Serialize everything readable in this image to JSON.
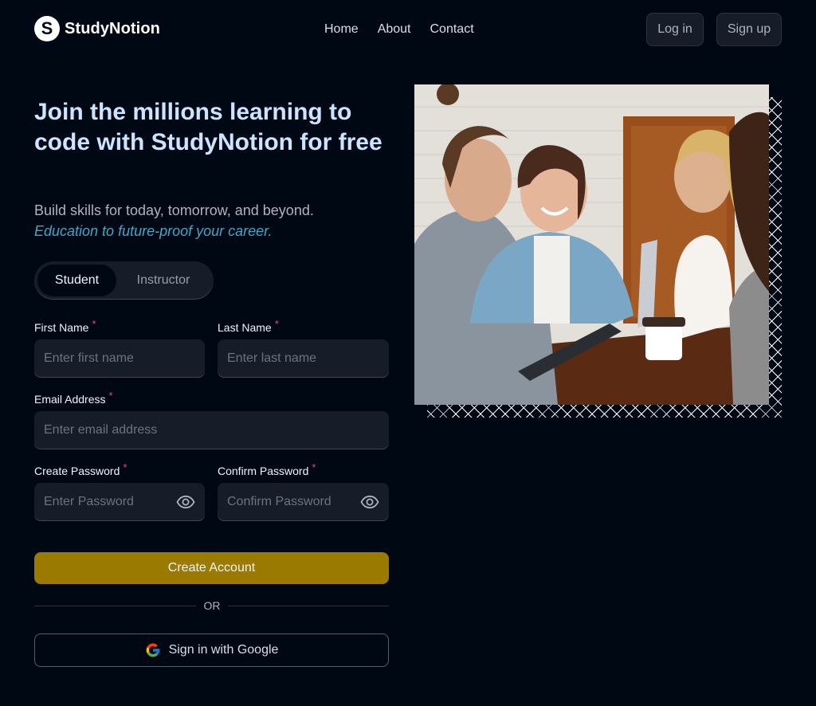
{
  "brand": {
    "name": "StudyNotion",
    "mark": "S"
  },
  "nav": {
    "links": [
      "Home",
      "About",
      "Contact"
    ],
    "login": "Log in",
    "signup": "Sign up"
  },
  "hero": {
    "heading": "Join the millions learning to code with StudyNotion for free",
    "sub1": "Build skills for today, tomorrow, and beyond.",
    "sub2": "Education to future-proof your career."
  },
  "account_type": {
    "options": [
      "Student",
      "Instructor"
    ],
    "selected": "Student"
  },
  "form": {
    "first_name": {
      "label": "First Name",
      "placeholder": "Enter first name"
    },
    "last_name": {
      "label": "Last Name",
      "placeholder": "Enter last name"
    },
    "email": {
      "label": "Email Address",
      "placeholder": "Enter email address"
    },
    "password": {
      "label": "Create Password",
      "placeholder": "Enter Password"
    },
    "confirm_password": {
      "label": "Confirm Password",
      "placeholder": "Confirm Password"
    },
    "required_mark": "*",
    "submit": "Create Account",
    "divider": "OR",
    "google": "Sign in with Google"
  },
  "colors": {
    "background": "#000814",
    "accent_yellow": "#9A7B00",
    "heading_blue": "#CCE4FF",
    "italic_cyan": "#47A5C5",
    "required_pink": "#EF476F"
  },
  "icons": [
    "eye-icon",
    "google-icon",
    "checker-frame"
  ]
}
